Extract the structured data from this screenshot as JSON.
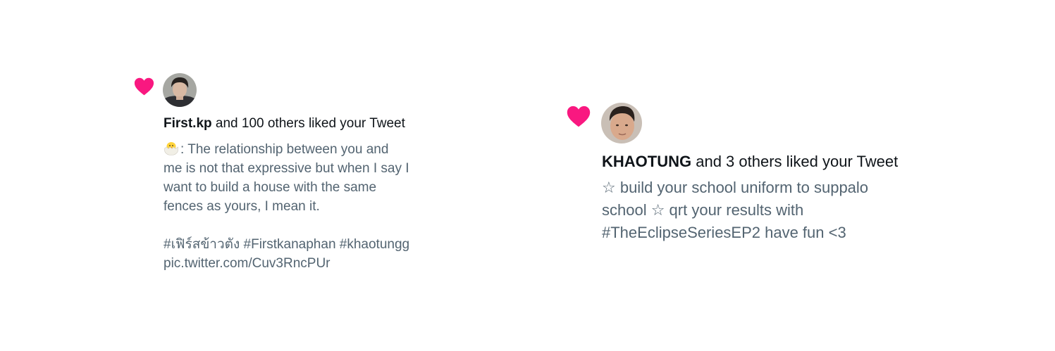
{
  "colors": {
    "heart": "#f91880",
    "text_primary": "#0f1419",
    "text_secondary": "#536471",
    "background": "#ffffff"
  },
  "notifications": [
    {
      "icon": "heart-icon",
      "avatar": "user-avatar",
      "user": "First.kp",
      "action": " and 100 others liked your Tweet",
      "emoji": "hatching-chick-emoji",
      "lines": [
        ": The relationship between you and",
        "me is not that expressive but when I say I",
        "want to build a house with the same",
        "fences as yours, I mean it."
      ],
      "tag_lines": [
        "#เฟิร์สข้าวตัง #Firstkanaphan #khaotungg",
        "pic.twitter.com/Cuv3RncPUr"
      ]
    },
    {
      "icon": "heart-icon",
      "avatar": "user-avatar",
      "user": "KHAOTUNG",
      "action": " and 3 others liked your Tweet",
      "lines": [
        "☆ build your school uniform to suppalo",
        "school ☆ qrt your results with",
        "#TheEclipseSeriesEP2 have fun <3"
      ]
    }
  ]
}
